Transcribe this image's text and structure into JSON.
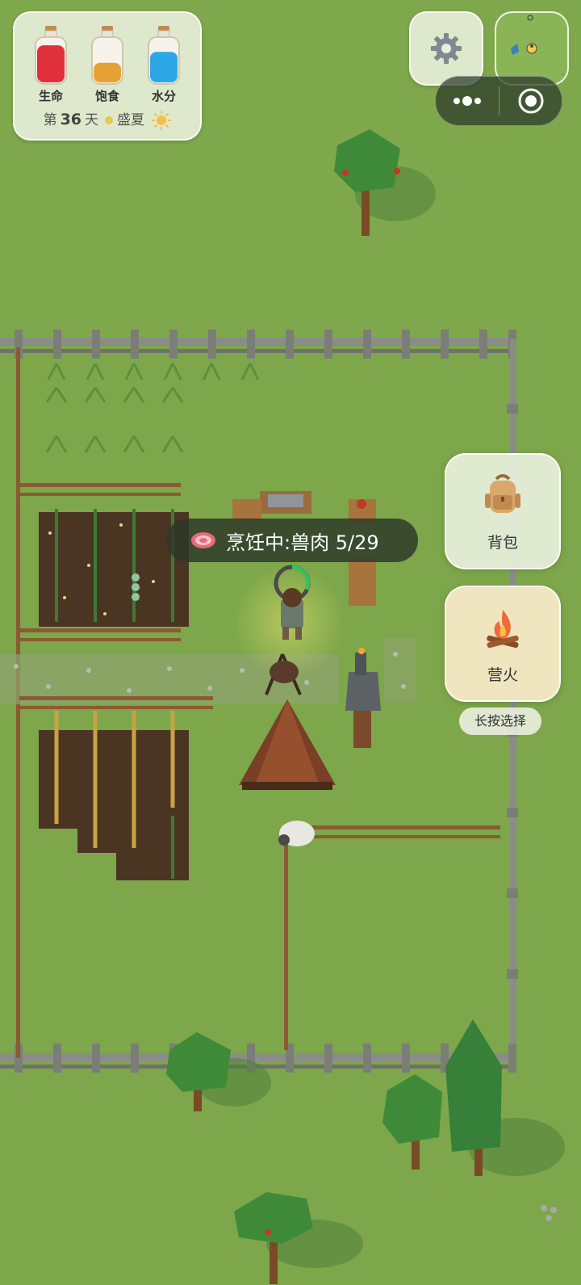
{
  "stats": {
    "health": {
      "label": "生命",
      "fill": 0.85,
      "color": "#e0303c"
    },
    "food": {
      "label": "饱食",
      "fill": 0.45,
      "color": "#e7a233"
    },
    "water": {
      "label": "水分",
      "fill": 0.7,
      "color": "#2ea7e6"
    }
  },
  "day": {
    "prefix": "第",
    "number": "36",
    "suffix": "天",
    "season": "盛夏"
  },
  "buttons": {
    "backpack": "背包",
    "campfire": "营火",
    "long_press_hint": "长按选择"
  },
  "cooking": {
    "text": "烹饪中:兽肉 5/29",
    "progress": 0.17
  },
  "icons": {
    "settings": "gear-icon",
    "more": "more-dots-icon",
    "close": "target-close-icon",
    "backpack": "backpack-icon",
    "campfire": "campfire-icon",
    "meat": "meat-icon",
    "season": "sun-icon"
  },
  "colors": {
    "grass": "#7da74a",
    "soil": "#4a3422",
    "fence_stone": "#8a8d86",
    "fence_wood": "#8b5a32"
  }
}
